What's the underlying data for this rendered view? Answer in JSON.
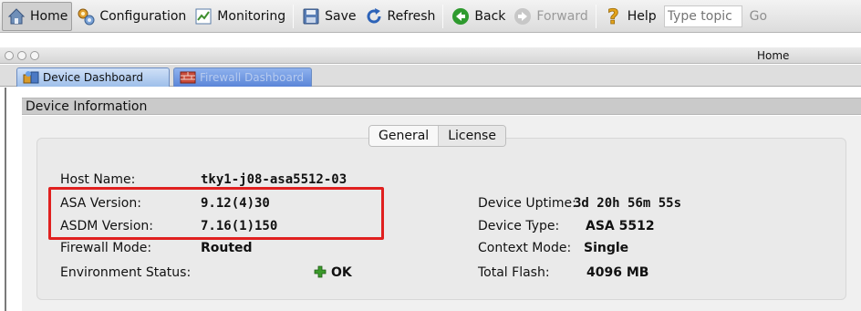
{
  "toolbar": {
    "home_label": "Home",
    "configuration_label": "Configuration",
    "monitoring_label": "Monitoring",
    "save_label": "Save",
    "refresh_label": "Refresh",
    "back_label": "Back",
    "forward_label": "Forward",
    "help_label": "Help",
    "search_placeholder": "Type topic",
    "go_label": "Go"
  },
  "window": {
    "title": "Home"
  },
  "tabs": [
    {
      "label": "Device Dashboard",
      "icon": "dashboard-icon"
    },
    {
      "label": "Firewall Dashboard",
      "icon": "firewall-icon"
    }
  ],
  "panel": {
    "title": "Device Information",
    "subtabs": [
      "General",
      "License"
    ]
  },
  "device": {
    "host_name_label": "Host Name:",
    "host_name": "tky1-j08-asa5512-03",
    "asa_version_label": "ASA Version:",
    "asa_version": "9.12(4)30",
    "asdm_version_label": "ASDM Version:",
    "asdm_version": "7.16(1)150",
    "firewall_mode_label": "Firewall Mode:",
    "firewall_mode": "Routed",
    "env_status_label": "Environment Status:",
    "env_status": "OK",
    "uptime_label": "Device Uptime:",
    "uptime": "3d 20h 56m 55s",
    "device_type_label": "Device Type:",
    "device_type": "ASA 5512",
    "context_mode_label": "Context Mode:",
    "context_mode": "Single",
    "total_flash_label": "Total Flash:",
    "total_flash": "4096 MB"
  },
  "colors": {
    "highlight": "#e0201f",
    "tab_active": "#9ebfea",
    "tab_inactive": "#5a85d8",
    "status_ok": "#3a9a2a"
  }
}
